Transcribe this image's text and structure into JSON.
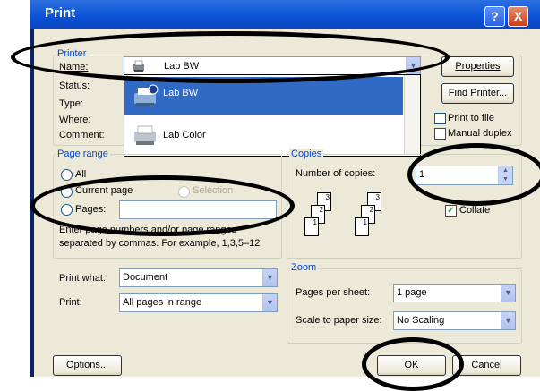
{
  "dialog": {
    "title": "Print",
    "help_symbol": "?",
    "close_symbol": "X"
  },
  "printer": {
    "group_label": "Printer",
    "name_label": "Name:",
    "status_label": "Status:",
    "type_label": "Type:",
    "where_label": "Where:",
    "comment_label": "Comment:",
    "selected": "Lab BW",
    "options": [
      "Lab BW",
      "Lab Color"
    ],
    "properties_button": "Properties",
    "find_printer_button": "Find Printer...",
    "print_to_file_label": "Print to file",
    "manual_duplex_label": "Manual duplex"
  },
  "page_range": {
    "group_label": "Page range",
    "all_label": "All",
    "current_page_label": "Current page",
    "selection_label": "Selection",
    "pages_label": "Pages:",
    "pages_value": "",
    "help_line1": "Enter page numbers and/or page ranges",
    "help_line2": "separated by commas.  For example, 1,3,5–12"
  },
  "copies": {
    "group_label": "Copies",
    "number_label": "Number of copies:",
    "value": "1",
    "collate_label": "Collate",
    "collate_checked": true,
    "page_numbers": [
      "1",
      "2",
      "3"
    ]
  },
  "print_what": {
    "label": "Print what:",
    "value": "Document"
  },
  "print": {
    "label": "Print:",
    "value": "All pages in range"
  },
  "zoom": {
    "group_label": "Zoom",
    "pages_per_sheet_label": "Pages per sheet:",
    "pages_per_sheet_value": "1 page",
    "scale_label": "Scale to paper size:",
    "scale_value": "No Scaling"
  },
  "buttons": {
    "options": "Options...",
    "ok": "OK",
    "cancel": "Cancel"
  },
  "colors": {
    "title_bar": "#0a52d6",
    "dialog_bg": "#ece9d8",
    "group_title": "#0046d5",
    "selection": "#316ac5"
  }
}
